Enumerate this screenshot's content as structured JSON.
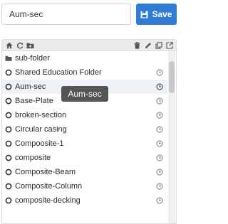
{
  "header": {
    "name_input": {
      "value": "Aum-sec"
    },
    "save_button": {
      "label": "Save",
      "icon": "floppy-disk-icon"
    }
  },
  "toolbar": {
    "left_icons": [
      "home-icon",
      "refresh-icon",
      "new-folder-icon"
    ],
    "right_icons": [
      "trash-icon",
      "pencil-icon",
      "copy-icon",
      "external-link-icon"
    ]
  },
  "list": {
    "items": [
      {
        "label": "sub-folder",
        "icon": "folder-icon",
        "clock": false,
        "selected": false
      },
      {
        "label": "Shared Education Folder",
        "icon": "circle-icon",
        "clock": true,
        "selected": false
      },
      {
        "label": "Aum-sec",
        "icon": "circle-icon",
        "clock": true,
        "selected": true
      },
      {
        "label": "Base-Plate",
        "icon": "circle-icon",
        "clock": true,
        "selected": false
      },
      {
        "label": "broken-section",
        "icon": "circle-icon",
        "clock": true,
        "selected": false
      },
      {
        "label": "Circular casing",
        "icon": "circle-icon",
        "clock": true,
        "selected": false
      },
      {
        "label": "Compoosite-1",
        "icon": "circle-icon",
        "clock": true,
        "selected": false
      },
      {
        "label": "composite",
        "icon": "circle-icon",
        "clock": true,
        "selected": false
      },
      {
        "label": "Composite-Beam",
        "icon": "circle-icon",
        "clock": true,
        "selected": false
      },
      {
        "label": "Composite-Column",
        "icon": "circle-icon",
        "clock": true,
        "selected": false
      },
      {
        "label": "composite-decking",
        "icon": "circle-icon",
        "clock": true,
        "selected": false
      }
    ]
  },
  "tooltip": {
    "text": "Aum-sec"
  },
  "colors": {
    "accent": "#2e7cd6",
    "toolbar_bg": "#e9ebee",
    "tooltip_bg": "#555555"
  }
}
